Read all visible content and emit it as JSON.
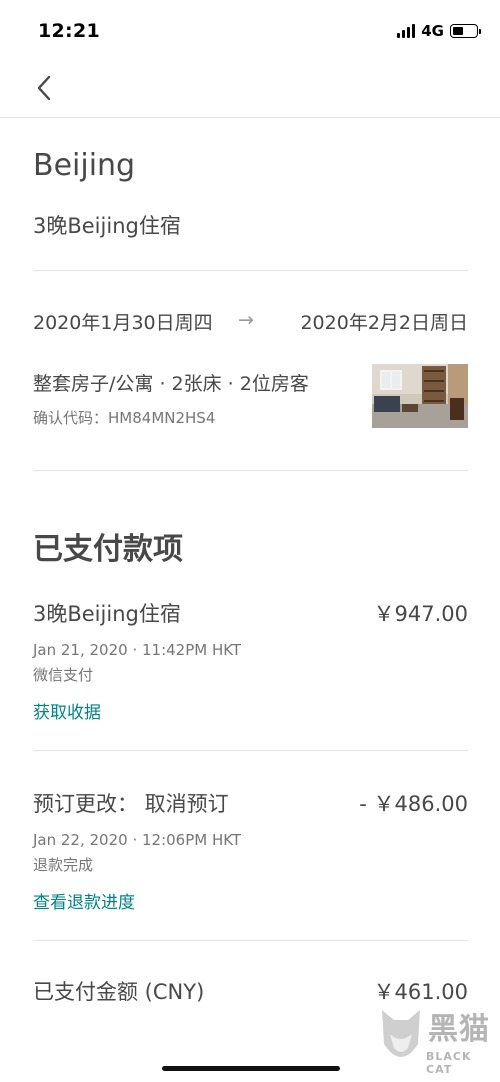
{
  "status_bar": {
    "time": "12:21",
    "network": "4G",
    "battery_level": 0.45
  },
  "nav": {
    "back_icon": "chevron-left-icon"
  },
  "trip": {
    "city": "Beijing",
    "stay_title": "3晚Beijing住宿",
    "check_in": "2020年1月30日周四",
    "arrow": "→",
    "check_out": "2020年2月2日周日",
    "listing_desc": "整套房子/公寓 · 2张床 · 2位房客",
    "confirm_label": "确认代码：",
    "confirm_code": "HM84MN2HS4"
  },
  "payments": {
    "section_title": "已支付款项",
    "items": [
      {
        "name": "3晚Beijing住宿",
        "amount": "￥947.00",
        "datetime": "Jan 21, 2020 · 11:42PM HKT",
        "status": "微信支付",
        "link": "获取收据"
      },
      {
        "name": "预订更改：  取消预订",
        "amount": "- ￥486.00",
        "datetime": "Jan 22, 2020 · 12:06PM HKT",
        "status": "退款完成",
        "link": "查看退款进度"
      }
    ],
    "total_label": "已支付金额 (CNY)",
    "total_amount": "￥461.00"
  },
  "watermark": {
    "text": "黑猫",
    "sub": "BLACK CAT"
  },
  "colors": {
    "text": "#484848",
    "muted": "#767676",
    "link": "#008489",
    "divider": "#e4e4e4"
  }
}
